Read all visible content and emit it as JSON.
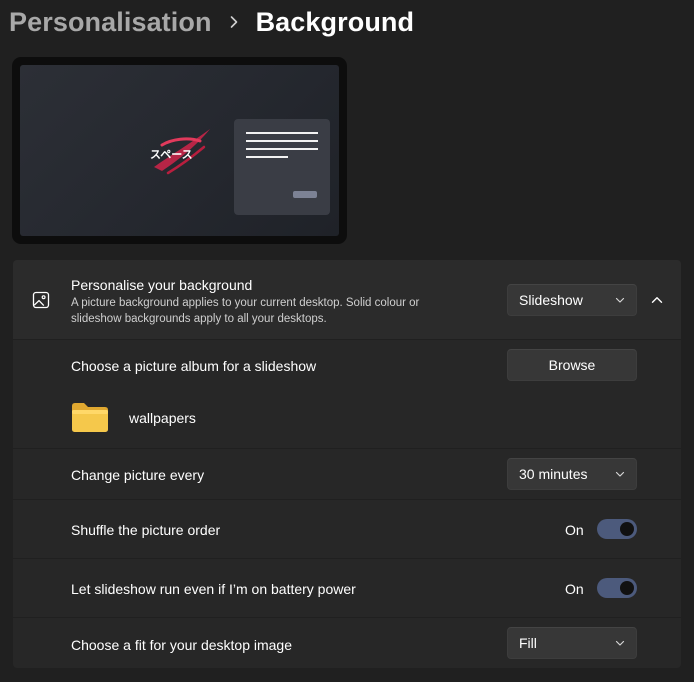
{
  "breadcrumb": {
    "parent": "Personalisation",
    "separator_icon": "chevron-right-icon",
    "current": "Background"
  },
  "preview": {
    "logo_text": "スペース",
    "window_icon": "window-mockup"
  },
  "personalise": {
    "icon": "picture-icon",
    "title": "Personalise your background",
    "description": "A picture background applies to your current desktop. Solid colour or slideshow backgrounds apply to all your desktops.",
    "selected": "Slideshow",
    "expanded": true
  },
  "album": {
    "label": "Choose a picture album for a slideshow",
    "browse_label": "Browse",
    "folder_icon": "folder-icon",
    "folder_name": "wallpapers"
  },
  "change_interval": {
    "label": "Change picture every",
    "selected": "30 minutes"
  },
  "shuffle": {
    "label": "Shuffle the picture order",
    "state": "On",
    "on": true
  },
  "battery": {
    "label": "Let slideshow run even if I’m on battery power",
    "state": "On",
    "on": true
  },
  "fit": {
    "label": "Choose a fit for your desktop image",
    "selected": "Fill"
  },
  "colors": {
    "background": "#202020",
    "card": "#2b2b2b",
    "toggle_on": "#4c5a7c",
    "folder": "#f5c84b"
  }
}
